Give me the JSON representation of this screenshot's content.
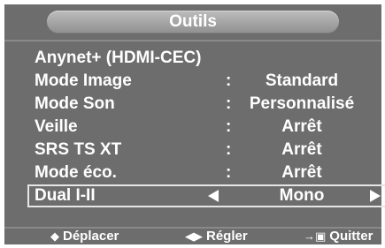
{
  "title": "Outils",
  "menu": {
    "items": [
      {
        "label": "Anynet+ (HDMI-CEC)",
        "colon": "",
        "value": ""
      },
      {
        "label": "Mode Image",
        "colon": ":",
        "value": "Standard"
      },
      {
        "label": "Mode Son",
        "colon": ":",
        "value": "Personnalisé"
      },
      {
        "label": "Veille",
        "colon": ":",
        "value": "Arrêt"
      },
      {
        "label": "SRS TS XT",
        "colon": ":",
        "value": "Arrêt"
      },
      {
        "label": "Mode éco.",
        "colon": ":",
        "value": "Arrêt"
      },
      {
        "label": "Dual I-II",
        "colon": "",
        "value": "Mono"
      }
    ],
    "selected_index": 6
  },
  "footer": {
    "move": {
      "icon": "up-down-arrows-icon",
      "glyph": "◆",
      "label": "Déplacer"
    },
    "adjust": {
      "icon": "left-right-arrows-icon",
      "glyph": "◀▶",
      "label": "Régler"
    },
    "exit": {
      "icon": "exit-icon",
      "glyph": "→▣",
      "label": "Quitter"
    }
  },
  "colors": {
    "background": "#6d6d6d",
    "text": "#ffffff",
    "highlight_border": "#e6e6e6"
  }
}
